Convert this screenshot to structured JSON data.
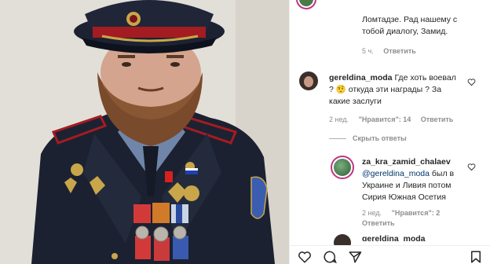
{
  "comments": {
    "c1_text": "Ломтадзе. Рад нашему с тобой диалогу, Замид.",
    "c1_time": "5 ч.",
    "c1_reply": "Ответить",
    "c2_user": "gereldina_moda",
    "c2_text": "Где хоть воевал ? 🤨 откуда эти награды ? За какие заслуги",
    "c2_time": "2 нед.",
    "c2_likes": "\"Нравится\": 14",
    "c2_reply": "Ответить",
    "hide_replies": "Скрыть ответы",
    "c3_user": "za_kra_zamid_chalaev",
    "c3_mention": "@gereldina_moda",
    "c3_text": "был в Украине и Ливия потом Сирия Южная Осетия",
    "c3_time": "2 нед.",
    "c3_likes": "\"Нравится\": 2",
    "c3_reply": "Ответить",
    "c4_user_partial": "gereldina_moda"
  },
  "colors": {
    "text": "#262626",
    "meta": "#8e8e8e",
    "mention": "#00376b",
    "uniform": "#1b2130",
    "piping": "#a31c22"
  },
  "icons": [
    "heart-icon",
    "comment-icon",
    "share-icon",
    "bookmark-icon"
  ]
}
